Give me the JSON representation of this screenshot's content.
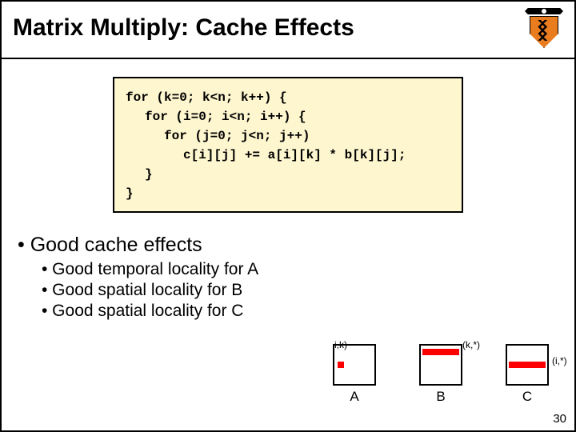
{
  "title": "Matrix Multiply: Cache Effects",
  "code": {
    "l1": "for (k=0; k<n; k++) {",
    "l2": "for (i=0; i<n; i++) {",
    "l3": "for (j=0; j<n; j++)",
    "l4": "c[i][j] += a[i][k] * b[k][j];",
    "c1": "}",
    "c2": "}"
  },
  "bullets": {
    "b1": "• Good cache effects",
    "b2a": "• Good temporal locality for A",
    "b2b": "• Good spatial locality for B",
    "b2c": "• Good spatial locality for C"
  },
  "diag": {
    "A": "A",
    "B": "B",
    "C": "C",
    "ik": "i,k)",
    "kstar": "(k,*)",
    "istar": "(i,*)"
  },
  "pagenum": "30"
}
